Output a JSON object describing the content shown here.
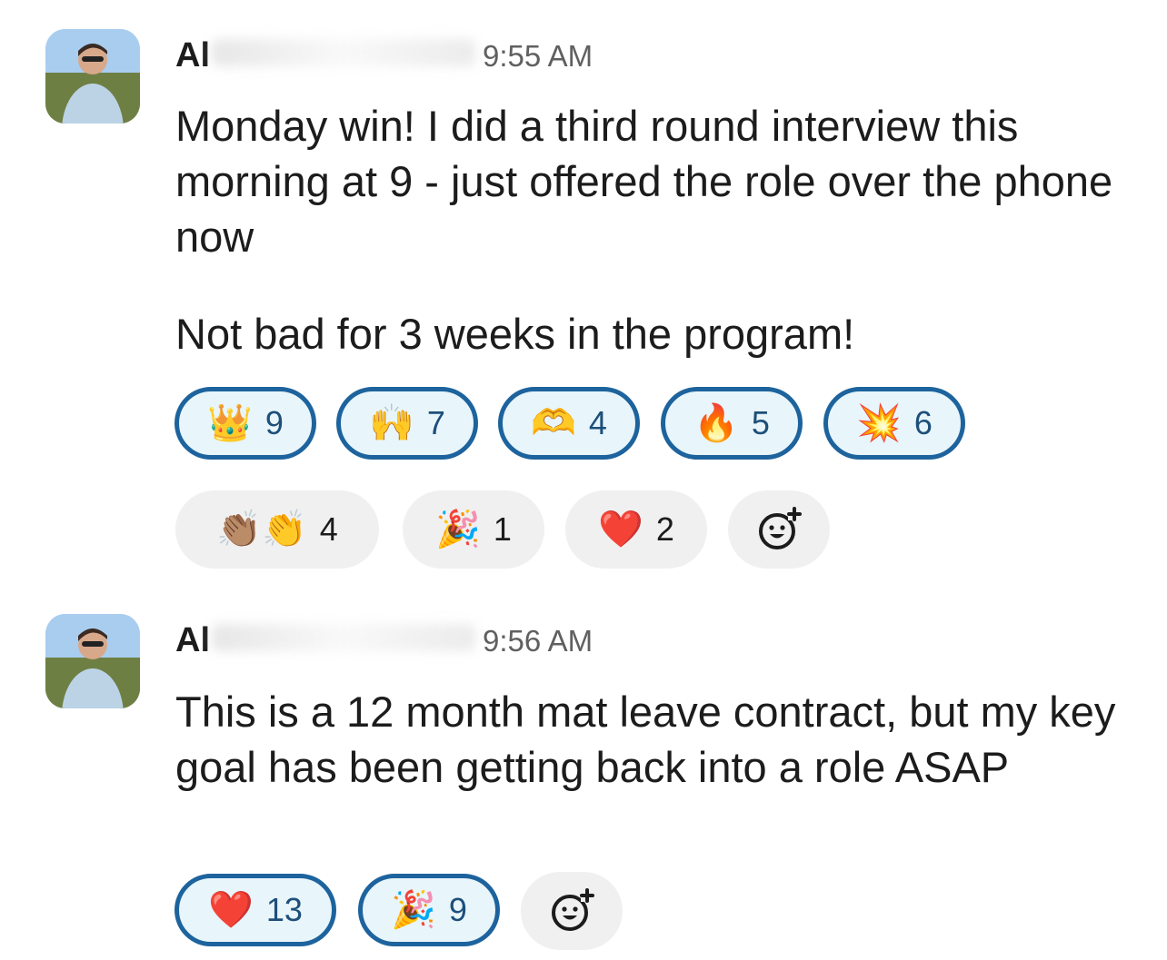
{
  "messages": [
    {
      "author": "Al",
      "time": "9:55 AM",
      "paragraphs": [
        "Monday win! I did a third round interview this morning at 9 - just offered the role over the phone now",
        "Not bad for 3 weeks in the program!"
      ],
      "reactions_row1": [
        {
          "emoji": "👑",
          "name": "crown-icon",
          "count": "9"
        },
        {
          "emoji": "🙌",
          "name": "raised-hands-icon",
          "count": "7"
        },
        {
          "emoji": "🫶",
          "name": "heart-hands-icon",
          "count": "4"
        },
        {
          "emoji": "🔥",
          "name": "fire-icon",
          "count": "5"
        },
        {
          "emoji": "💥",
          "name": "collision-icon",
          "count": "6"
        }
      ],
      "reactions_row2": [
        {
          "emoji": "👏🏽👏",
          "name": "clapping-icon",
          "count": "4"
        },
        {
          "emoji": "🎉",
          "name": "party-popper-icon",
          "count": "1"
        },
        {
          "emoji": "❤️",
          "name": "red-heart-icon",
          "count": "2"
        }
      ]
    },
    {
      "author": "Al",
      "time": "9:56 AM",
      "paragraphs": [
        "This is a 12 month mat leave contract, but my key goal has been getting back into a role ASAP"
      ],
      "reactions": [
        {
          "emoji": "❤️",
          "name": "red-heart-icon",
          "count": "13"
        },
        {
          "emoji": "🎉",
          "name": "party-popper-icon",
          "count": "9"
        }
      ]
    }
  ],
  "add_reaction_icon": "add-reaction-icon",
  "colors": {
    "active_border": "#1d639d",
    "active_bg": "#e8f5fa",
    "count_active": "#1d4f7a",
    "plain_bg": "#f0f0f0",
    "timestamp": "#616061"
  }
}
